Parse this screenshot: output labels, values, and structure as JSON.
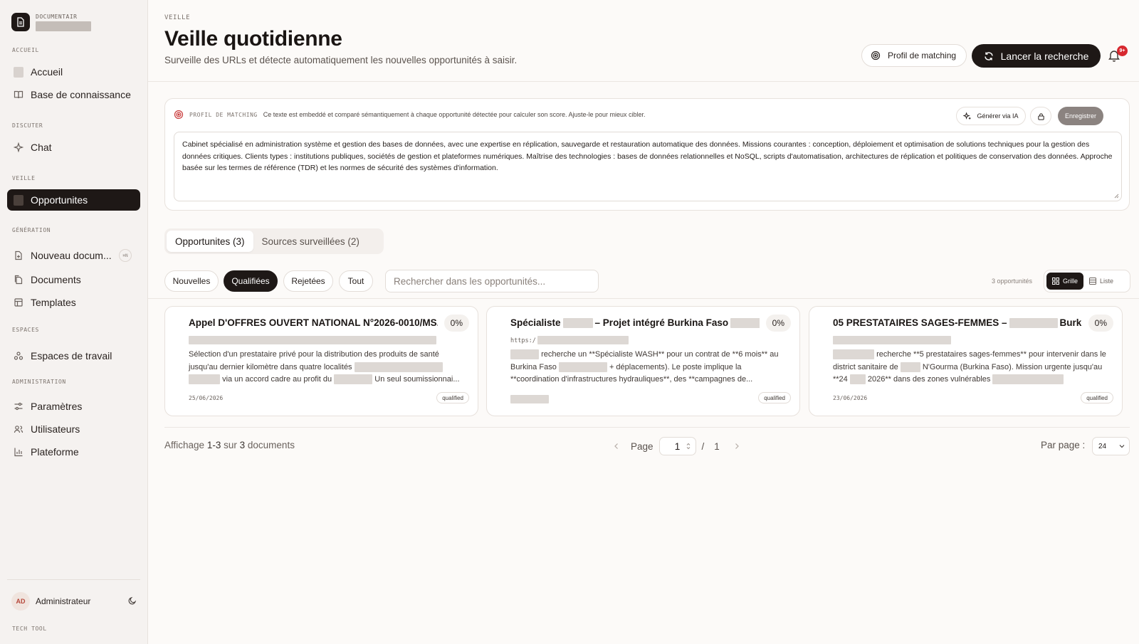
{
  "sidebar": {
    "brand_name": "DOCUMENTAIR",
    "sections": {
      "accueil": "ACCUEIL",
      "discuter": "DISCUTER",
      "veille": "VEILLE",
      "generation": "GÉNÉRATION",
      "espaces": "ESPACES",
      "administration": "ADMINISTRATION"
    },
    "items": {
      "accueil": "Accueil",
      "base": "Base de connaissance",
      "chat": "Chat",
      "opportunites": "Opportunites",
      "nouveau": "Nouveau docum...",
      "nouveau_kbd": "⌘N",
      "documents": "Documents",
      "templates": "Templates",
      "espaces": "Espaces de travail",
      "parametres": "Paramètres",
      "utilisateurs": "Utilisateurs",
      "plateforme": "Plateforme"
    },
    "user": {
      "initials": "AD",
      "name": "Administrateur"
    },
    "footer_label": "TECH TOOL"
  },
  "header": {
    "eyebrow": "VEILLE",
    "title": "Veille quotidienne",
    "subtitle": "Surveille des URLs et détecte automatiquement les nouvelles opportunités à saisir.",
    "profile_button": "Profil de matching",
    "search_button": "Lancer la recherche",
    "notification_count": "9+"
  },
  "profile": {
    "label": "PROFIL DE MATCHING",
    "description": "Ce texte est embeddé et comparé sémantiquement à chaque opportunité détectée pour calculer son score. Ajuste-le pour mieux cibler.",
    "generate_button": "Générer via IA",
    "save_button": "Enregistrer",
    "text": "Cabinet spécialisé en administration système et gestion des bases de données, avec une expertise en réplication, sauvegarde et restauration automatique des données. Missions courantes : conception, déploiement et optimisation de solutions techniques pour la gestion des données critiques. Clients types : institutions publiques, sociétés de gestion et plateformes numériques. Maîtrise des technologies : bases de données relationnelles et NoSQL, scripts d'automatisation, architectures de réplication et politiques de conservation des données. Approche basée sur les termes de référence (TDR) et les normes de sécurité des systèmes d'information."
  },
  "tabs": [
    {
      "label": "Opportunites (3)"
    },
    {
      "label": "Sources surveillées (2)"
    }
  ],
  "filters": {
    "chips": [
      "Nouvelles",
      "Qualifiées",
      "Rejetées",
      "Tout"
    ],
    "search_placeholder": "Rechercher dans les opportunités...",
    "count": "3 opportunités",
    "view_grid": "Grille",
    "view_list": "Liste"
  },
  "cards": [
    {
      "title": "Appel D'OFFRES OUVERT NATIONAL N°2026-0010/MS...",
      "score": "0%",
      "desc_a": "Sélection d'un prestataire privé pour la distribution des produits de santé jusqu'au dernier kilomètre dans quatre localités",
      "desc_b": "via un accord cadre au profit du",
      "desc_c": "Un seul soumissionnai...",
      "date": "25/06/2026",
      "tag": "qualified"
    },
    {
      "title_a": "Spécialiste",
      "title_b": "– Projet intégré Burkina Faso",
      "score": "0%",
      "url": "https:/",
      "desc_a": "recherche un **Spécialiste WASH** pour un contrat de **6 mois** au Burkina Faso",
      "desc_b": "+ déplacements). Le poste implique la **coordination d'infrastructures hydrauliques**, des **campagnes de...",
      "tag": "qualified"
    },
    {
      "title_a": "05 PRESTATAIRES SAGES-FEMMES –",
      "title_b": "Burkin...",
      "score": "0%",
      "desc_a": "recherche **5 prestataires sages-femmes** pour intervenir dans le district sanitaire de",
      "desc_b": "N'Gourma (Burkina Faso). Mission urgente jusqu'au **24",
      "desc_c": "2026** dans des zones vulnérables",
      "date": "23/06/2026",
      "tag": "qualified"
    }
  ],
  "pagination": {
    "showing_prefix": "Affichage",
    "showing_range": "1-3",
    "showing_mid": "sur",
    "showing_total": "3",
    "showing_suffix": "documents",
    "page_label": "Page",
    "page_value": "1",
    "page_sep": "/",
    "page_total": "1",
    "per_page_label": "Par page :",
    "per_page_value": "24"
  }
}
